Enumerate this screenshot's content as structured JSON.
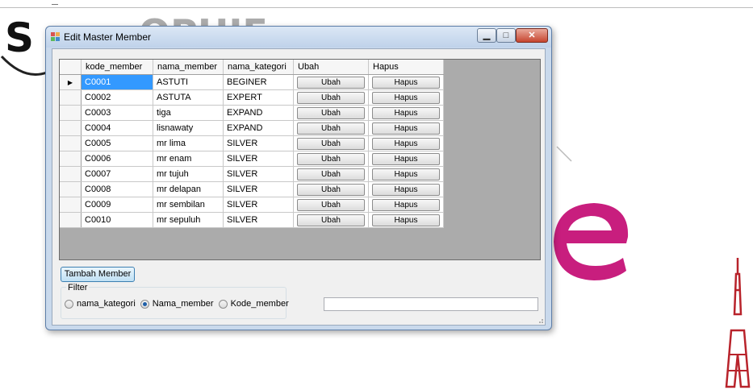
{
  "background": {
    "logo_s": "S",
    "logo_rest": "OPHIE"
  },
  "window": {
    "title": "Edit Master Member",
    "controls": {
      "minimize": "▁",
      "maximize": "□",
      "close": "✕"
    }
  },
  "grid": {
    "columns": [
      "kode_member",
      "nama_member",
      "nama_kategori",
      "Ubah",
      "Hapus"
    ],
    "rows": [
      {
        "kode": "C0001",
        "nama": "ASTUTI",
        "kategori": "BEGINER"
      },
      {
        "kode": "C0002",
        "nama": "ASTUTA",
        "kategori": "EXPERT"
      },
      {
        "kode": "C0003",
        "nama": "tiga",
        "kategori": "EXPAND"
      },
      {
        "kode": "C0004",
        "nama": "lisnawaty",
        "kategori": "EXPAND"
      },
      {
        "kode": "C0005",
        "nama": "mr lima",
        "kategori": "SILVER"
      },
      {
        "kode": "C0006",
        "nama": "mr enam",
        "kategori": "SILVER"
      },
      {
        "kode": "C0007",
        "nama": "mr tujuh",
        "kategori": "SILVER"
      },
      {
        "kode": "C0008",
        "nama": "mr delapan",
        "kategori": "SILVER"
      },
      {
        "kode": "C0009",
        "nama": "mr sembilan",
        "kategori": "SILVER"
      },
      {
        "kode": "C0010",
        "nama": "mr sepuluh",
        "kategori": "SILVER"
      }
    ],
    "ubah_label": "Ubah",
    "hapus_label": "Hapus",
    "selected_row_marker": "▶"
  },
  "actions": {
    "add_member_label": "Tambah Member"
  },
  "filter": {
    "legend": "Filter",
    "options": [
      {
        "label": "nama_kategori",
        "checked": false
      },
      {
        "label": "Nama_member",
        "checked": true
      },
      {
        "label": "Kode_member",
        "checked": false
      }
    ],
    "search_value": ""
  },
  "colors": {
    "selection": "#3399ff",
    "accent_pink": "#c81e7e"
  }
}
